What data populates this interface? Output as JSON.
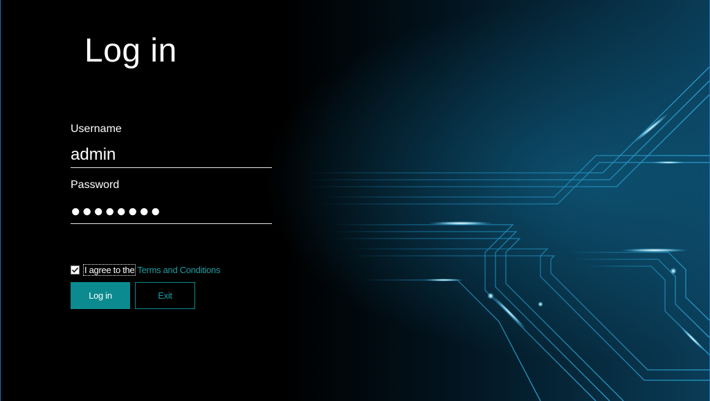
{
  "title": "Log in",
  "username": {
    "label": "Username",
    "value": "admin"
  },
  "password": {
    "label": "Password",
    "value": "●●●●●●●●"
  },
  "agreement": {
    "checked": true,
    "text": "I agree to the",
    "link_text": "Terms and Conditions"
  },
  "buttons": {
    "login_label": "Log in",
    "exit_label": "Exit"
  },
  "colors": {
    "accent": "#0b8b8f",
    "link": "#1d9ea1",
    "background": "#000000",
    "circuit_glow": "#1c7fa8"
  },
  "icons": {
    "checkbox": "checkmark-icon"
  }
}
